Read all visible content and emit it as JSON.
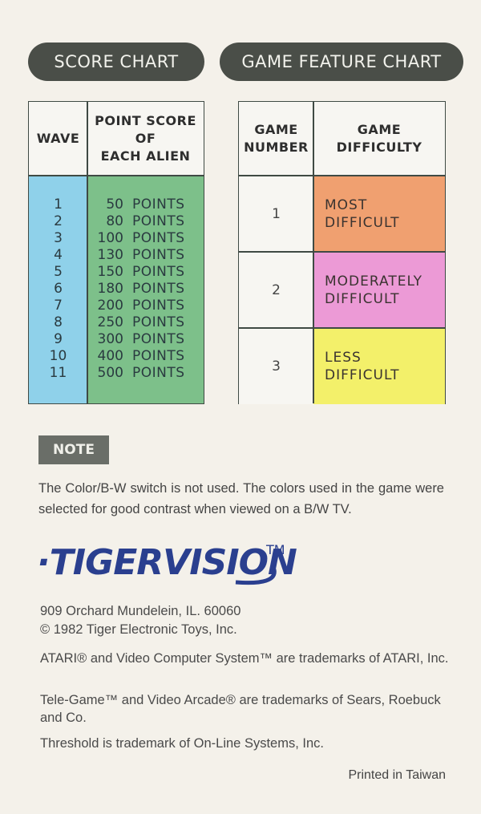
{
  "headers": {
    "score_chart": "SCORE  CHART",
    "game_feature_chart": "GAME FEATURE CHART"
  },
  "score_table": {
    "col_wave": "WAVE",
    "col_points_l1": "POINT SCORE",
    "col_points_l2": "OF",
    "col_points_l3": "EACH ALIEN",
    "rows": [
      {
        "wave": "1",
        "score": "50",
        "unit": "POINTS"
      },
      {
        "wave": "2",
        "score": "80",
        "unit": "POINTS"
      },
      {
        "wave": "3",
        "score": "100",
        "unit": "POINTS"
      },
      {
        "wave": "4",
        "score": "130",
        "unit": "POINTS"
      },
      {
        "wave": "5",
        "score": "150",
        "unit": "POINTS"
      },
      {
        "wave": "6",
        "score": "180",
        "unit": "POINTS"
      },
      {
        "wave": "7",
        "score": "200",
        "unit": "POINTS"
      },
      {
        "wave": "8",
        "score": "250",
        "unit": "POINTS"
      },
      {
        "wave": "9",
        "score": "300",
        "unit": "POINTS"
      },
      {
        "wave": "10",
        "score": "400",
        "unit": "POINTS"
      },
      {
        "wave": "11",
        "score": "500",
        "unit": "POINTS"
      }
    ],
    "colors": {
      "wave": "#8fd1ea",
      "points": "#7dc08a"
    }
  },
  "feature_table": {
    "col_game_l1": "GAME",
    "col_game_l2": "NUMBER",
    "col_diff_l1": "GAME",
    "col_diff_l2": "DIFFICULTY",
    "rows": [
      {
        "number": "1",
        "difficulty": "MOST\nDIFFICULT",
        "color": "#f0a070"
      },
      {
        "number": "2",
        "difficulty": "MODERATELY\nDIFFICULT",
        "color": "#ec9ad6"
      },
      {
        "number": "3",
        "difficulty": "LESS\nDIFFICULT",
        "color": "#f3f06a"
      }
    ]
  },
  "note": {
    "label": "NOTE",
    "text": "The Color/B-W switch is not used.  The colors used in the game were selected for good contrast when viewed on a B/W TV."
  },
  "logo": {
    "text": "·TIGERVISION",
    "tm": "TM",
    "color": "#2a3f8f"
  },
  "footer": {
    "address": "909 Orchard Mundelein, IL. 60060",
    "copyright": "© 1982 Tiger Electronic Toys, Inc.",
    "atari": "ATARI® and Video Computer System™ are trademarks of ATARI, Inc.",
    "telegame": "Tele-Game™ and Video Arcade® are trademarks of Sears, Roebuck and Co.",
    "threshold": "Threshold is trademark of On-Line Systems, Inc.",
    "printed": "Printed in Taiwan"
  }
}
